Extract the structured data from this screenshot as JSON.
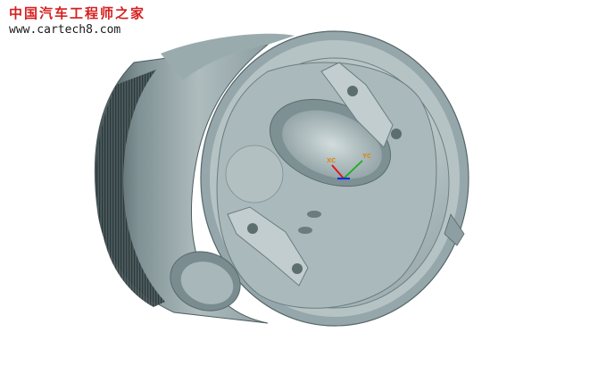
{
  "watermark": {
    "title": "中国汽车工程师之家",
    "url": "www.cartech8.com"
  },
  "triad": {
    "x_label": "XC",
    "y_label": "YC"
  },
  "colors": {
    "background": "#ffffff",
    "metal_light": "#b9c6c8",
    "metal_mid": "#8ea0a3",
    "metal_dark": "#5f7174",
    "watermark_red": "#d61f1f",
    "axis_x": "#e01010",
    "axis_y": "#18b018",
    "axis_z": "#1030e0"
  },
  "scene": {
    "object": "piston-3d-model"
  }
}
